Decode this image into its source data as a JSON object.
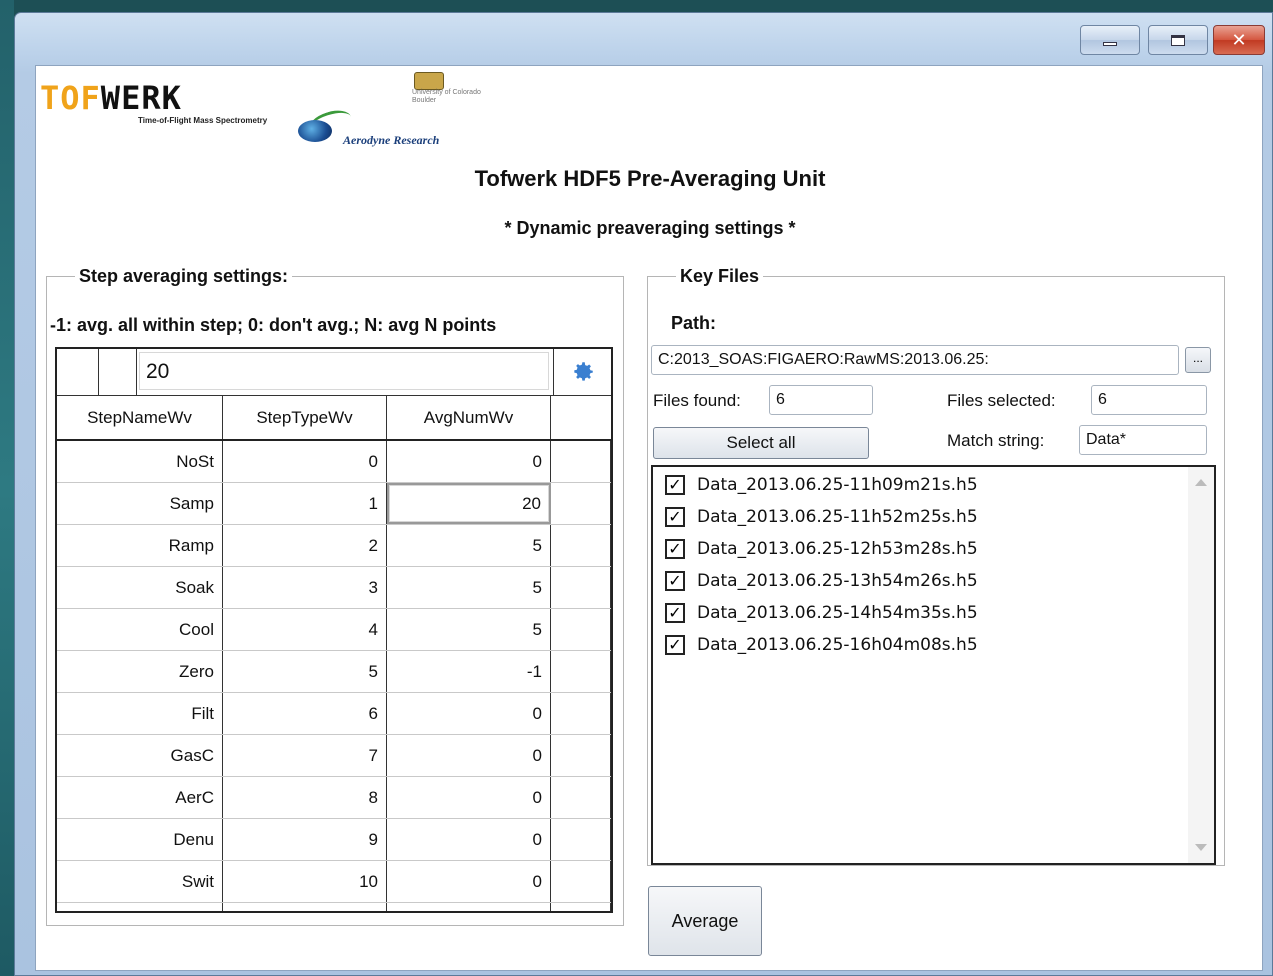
{
  "window": {
    "title": "",
    "accent": "#1d4f55",
    "controls": {
      "minimize": "minimize-icon",
      "maximize": "maximize-icon",
      "close": "close-icon"
    }
  },
  "header": {
    "logo_text_a": "TOF",
    "logo_text_b": "WERK",
    "logo_sub": "Time-of-Flight Mass Spectrometry",
    "aerodyne_label": "Aerodyne Research",
    "cu_text_1": "University of Colorado",
    "cu_text_2": "Boulder",
    "title": "Tofwerk HDF5 Pre-Averaging Unit",
    "subtitle": "* Dynamic preaveraging settings *"
  },
  "step_panel": {
    "legend": "Step averaging settings:",
    "note": "-1: avg. all within step; 0: don't avg.; N: avg N points",
    "edit_value": "20",
    "columns": [
      "StepNameWv",
      "StepTypeWv",
      "AvgNumWv"
    ],
    "rows": [
      {
        "name": "NoSt",
        "type": "0",
        "avg": "0"
      },
      {
        "name": "Samp",
        "type": "1",
        "avg": "20"
      },
      {
        "name": "Ramp",
        "type": "2",
        "avg": "5"
      },
      {
        "name": "Soak",
        "type": "3",
        "avg": "5"
      },
      {
        "name": "Cool",
        "type": "4",
        "avg": "5"
      },
      {
        "name": "Zero",
        "type": "5",
        "avg": "-1"
      },
      {
        "name": "Filt",
        "type": "6",
        "avg": "0"
      },
      {
        "name": "GasC",
        "type": "7",
        "avg": "0"
      },
      {
        "name": "AerC",
        "type": "8",
        "avg": "0"
      },
      {
        "name": "Denu",
        "type": "9",
        "avg": "0"
      },
      {
        "name": "Swit",
        "type": "10",
        "avg": "0"
      }
    ]
  },
  "key_files": {
    "legend": "Key Files",
    "path_label": "Path:",
    "path_value": "C:2013_SOAS:FIGAERO:RawMS:2013.06.25:",
    "browse_label": "...",
    "files_found_label": "Files found:",
    "files_found": "6",
    "files_selected_label": "Files selected:",
    "files_selected": "6",
    "select_all_label": "Select all",
    "match_label": "Match string:",
    "match_value": "Data*",
    "files": [
      "Data_2013.06.25-11h09m21s.h5",
      "Data_2013.06.25-11h52m25s.h5",
      "Data_2013.06.25-12h53m28s.h5",
      "Data_2013.06.25-13h54m26s.h5",
      "Data_2013.06.25-14h54m35s.h5",
      "Data_2013.06.25-16h04m08s.h5"
    ]
  },
  "actions": {
    "average_label": "Average"
  }
}
